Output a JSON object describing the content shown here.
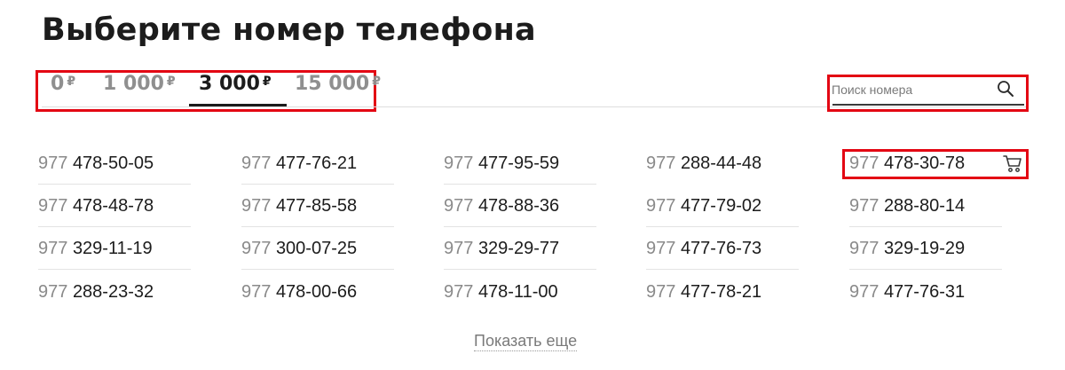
{
  "page": {
    "title": "Выберите номер телефона"
  },
  "tabs": [
    {
      "amount": "0",
      "currency": "₽",
      "active": false
    },
    {
      "amount": "1 000",
      "currency": "₽",
      "active": false
    },
    {
      "amount": "3 000",
      "currency": "₽",
      "active": true
    },
    {
      "amount": "15 000",
      "currency": "₽",
      "active": false
    }
  ],
  "search": {
    "placeholder": "Поиск номера",
    "value": "",
    "icon": "search-icon"
  },
  "numbers": {
    "prefix": "977",
    "rows": [
      [
        "478-50-05",
        "477-76-21",
        "477-95-59",
        "288-44-48",
        "478-30-78"
      ],
      [
        "478-48-78",
        "477-85-58",
        "478-88-36",
        "477-79-02",
        "288-80-14"
      ],
      [
        "329-11-19",
        "300-07-25",
        "329-29-77",
        "477-76-73",
        "329-19-29"
      ],
      [
        "288-23-32",
        "478-00-66",
        "478-11-00",
        "477-78-21",
        "477-76-31"
      ]
    ],
    "cart_icon": "cart-icon"
  },
  "more": {
    "label": "Показать еще"
  },
  "colors": {
    "highlight": "#e30613",
    "text": "#1c1c1c",
    "muted": "#8a8a8a"
  }
}
